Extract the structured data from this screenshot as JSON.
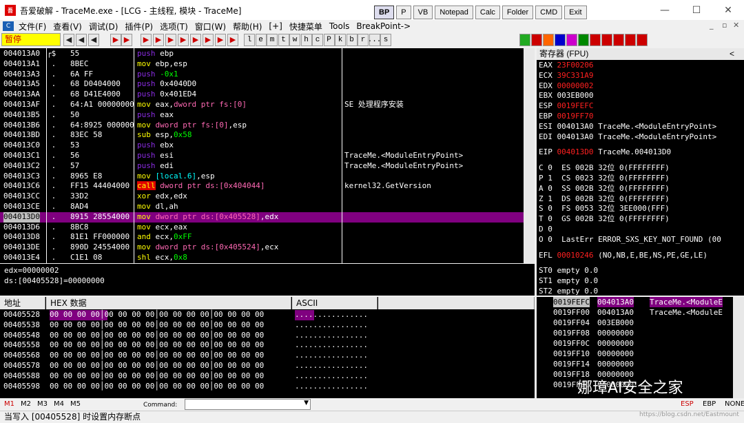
{
  "window": {
    "title": "吾爱破解 - TraceMe.exe - [LCG - 主线程, 模块 - TraceMe]",
    "icon_text": "吾"
  },
  "quick_buttons": [
    "BP",
    "P",
    "VB",
    "Notepad",
    "Calc",
    "Folder",
    "CMD",
    "Exit"
  ],
  "window_controls": {
    "min": "—",
    "max": "☐",
    "close": "✕"
  },
  "menu": [
    "文件(F)",
    "查看(V)",
    "调试(D)",
    "插件(P)",
    "选项(T)",
    "窗口(W)",
    "帮助(H)",
    "[+]",
    "快捷菜单",
    "Tools",
    "BreakPoint->"
  ],
  "mdi_controls": [
    "_",
    "▫",
    "✕"
  ],
  "toolbar": {
    "status": "暂停",
    "letters": [
      "l",
      "e",
      "m",
      "t",
      "w",
      "h",
      "c",
      "P",
      "k",
      "b",
      "r",
      "...",
      "s"
    ]
  },
  "disasm": [
    {
      "addr": "004013A0",
      "mark": "┌$",
      "hex": "55",
      "ins": [
        [
          "push",
          "t-push"
        ],
        [
          " ebp",
          "op"
        ]
      ],
      "cmt": ""
    },
    {
      "addr": "004013A1",
      "mark": " .",
      "hex": "8BEC",
      "ins": [
        [
          "mov",
          "t-mov"
        ],
        [
          " ebp,esp",
          "op"
        ]
      ],
      "cmt": ""
    },
    {
      "addr": "004013A3",
      "mark": " .",
      "hex": "6A FF",
      "ins": [
        [
          "push",
          "t-push"
        ],
        [
          " -0x1",
          "num"
        ]
      ],
      "cmt": ""
    },
    {
      "addr": "004013A5",
      "mark": " .",
      "hex": "68 D0404000",
      "ins": [
        [
          "push",
          "t-push"
        ],
        [
          " 0x4040D0",
          "op"
        ]
      ],
      "cmt": ""
    },
    {
      "addr": "004013AA",
      "mark": " .",
      "hex": "68 D41E4000",
      "ins": [
        [
          "push",
          "t-push"
        ],
        [
          " 0x401ED4",
          "op"
        ]
      ],
      "cmt": ""
    },
    {
      "addr": "004013AF",
      "mark": " .",
      "hex": "64:A1 00000000",
      "ins": [
        [
          "mov",
          "t-mov"
        ],
        [
          " eax,",
          "op"
        ],
        [
          "dword ptr fs:[0]",
          "mem"
        ]
      ],
      "cmt": "SE 处理程序安装"
    },
    {
      "addr": "004013B5",
      "mark": " .",
      "hex": "50",
      "ins": [
        [
          "push",
          "t-push"
        ],
        [
          " eax",
          "op"
        ]
      ],
      "cmt": ""
    },
    {
      "addr": "004013B6",
      "mark": " .",
      "hex": "64:8925 00000000",
      "ins": [
        [
          "mov",
          "t-mov"
        ],
        [
          " ",
          "op"
        ],
        [
          "dword ptr fs:[0]",
          "mem"
        ],
        [
          ",esp",
          "op"
        ]
      ],
      "cmt": ""
    },
    {
      "addr": "004013BD",
      "mark": " .",
      "hex": "83EC 58",
      "ins": [
        [
          "sub",
          "t-sub"
        ],
        [
          " esp,",
          "op"
        ],
        [
          "0x58",
          "num"
        ]
      ],
      "cmt": ""
    },
    {
      "addr": "004013C0",
      "mark": " .",
      "hex": "53",
      "ins": [
        [
          "push",
          "t-push"
        ],
        [
          " ebx",
          "op"
        ]
      ],
      "cmt": ""
    },
    {
      "addr": "004013C1",
      "mark": " .",
      "hex": "56",
      "ins": [
        [
          "push",
          "t-push"
        ],
        [
          " esi",
          "op"
        ]
      ],
      "cmt": "TraceMe.<ModuleEntryPoint>"
    },
    {
      "addr": "004013C2",
      "mark": " .",
      "hex": "57",
      "ins": [
        [
          "push",
          "t-push"
        ],
        [
          " edi",
          "op"
        ]
      ],
      "cmt": "TraceMe.<ModuleEntryPoint>"
    },
    {
      "addr": "004013C3",
      "mark": " .",
      "hex": "8965 E8",
      "ins": [
        [
          "mov",
          "t-mov"
        ],
        [
          " ",
          "op"
        ],
        [
          "[local.6]",
          "brk"
        ],
        [
          ",esp",
          "op"
        ]
      ],
      "cmt": ""
    },
    {
      "addr": "004013C6",
      "mark": " .",
      "hex": "FF15 44404000",
      "ins": [
        [
          "call",
          "t-call"
        ],
        [
          " ",
          "op"
        ],
        [
          "dword ptr ds:[0x404044]",
          "mem"
        ]
      ],
      "cmt": "kernel32.GetVersion"
    },
    {
      "addr": "004013CC",
      "mark": " .",
      "hex": "33D2",
      "ins": [
        [
          "xor",
          "t-xor"
        ],
        [
          " edx,edx",
          "op"
        ]
      ],
      "cmt": ""
    },
    {
      "addr": "004013CE",
      "mark": " .",
      "hex": "8AD4",
      "ins": [
        [
          "mov",
          "t-mov"
        ],
        [
          " dl,ah",
          "op"
        ]
      ],
      "cmt": ""
    },
    {
      "addr": "004013D0",
      "mark": " .",
      "hex": "8915 28554000",
      "ins": [
        [
          "mov",
          "t-mov"
        ],
        [
          " ",
          "op"
        ],
        [
          "dword ptr ds:[0x405528]",
          "mem"
        ],
        [
          ",edx",
          "op"
        ]
      ],
      "cmt": "",
      "sel": true
    },
    {
      "addr": "004013D6",
      "mark": " .",
      "hex": "8BC8",
      "ins": [
        [
          "mov",
          "t-mov"
        ],
        [
          " ecx,eax",
          "op"
        ]
      ],
      "cmt": ""
    },
    {
      "addr": "004013D8",
      "mark": " .",
      "hex": "81E1 FF000000",
      "ins": [
        [
          "and",
          "t-and"
        ],
        [
          " ecx,",
          "op"
        ],
        [
          "0xFF",
          "num"
        ]
      ],
      "cmt": ""
    },
    {
      "addr": "004013DE",
      "mark": " .",
      "hex": "890D 24554000",
      "ins": [
        [
          "mov",
          "t-mov"
        ],
        [
          " ",
          "op"
        ],
        [
          "dword ptr ds:[0x405524]",
          "mem"
        ],
        [
          ",ecx",
          "op"
        ]
      ],
      "cmt": ""
    },
    {
      "addr": "004013E4",
      "mark": " .",
      "hex": "C1E1 08",
      "ins": [
        [
          "shl",
          "t-shl"
        ],
        [
          " ecx,",
          "op"
        ],
        [
          "0x8",
          "num"
        ]
      ],
      "cmt": ""
    }
  ],
  "hint": [
    "edx=00000002",
    "ds:[00405528]=00000000"
  ],
  "registers": {
    "title": "寄存器 (FPU)",
    "lines": [
      {
        "t": "EAX ",
        "v": "23F00206",
        "c": "red",
        "r": ""
      },
      {
        "t": "ECX ",
        "v": "39C331A9",
        "c": "red",
        "r": ""
      },
      {
        "t": "EDX ",
        "v": "00000002",
        "c": "red",
        "r": ""
      },
      {
        "t": "EBX ",
        "v": "003EB000",
        "c": "",
        "r": ""
      },
      {
        "t": "ESP ",
        "v": "0019FEFC",
        "c": "red",
        "r": ""
      },
      {
        "t": "EBP ",
        "v": "0019FF70",
        "c": "red",
        "r": ""
      },
      {
        "t": "ESI ",
        "v": "004013A0",
        "c": "",
        "r": " TraceMe.<ModuleEntryPoint>"
      },
      {
        "t": "EDI ",
        "v": "004013A0",
        "c": "",
        "r": " TraceMe.<ModuleEntryPoint>"
      },
      {
        "t": "",
        "v": "",
        "c": "",
        "r": ""
      },
      {
        "t": "EIP ",
        "v": "004013D0",
        "c": "red",
        "r": " TraceMe.004013D0"
      },
      {
        "t": "",
        "v": "",
        "c": "",
        "r": ""
      },
      {
        "t": "C 0  ES 002B 32位 0(FFFFFFFF)",
        "v": "",
        "c": "",
        "r": ""
      },
      {
        "t": "P 1  CS 0023 32位 0(FFFFFFFF)",
        "v": "",
        "c": "",
        "r": ""
      },
      {
        "t": "A 0  SS 002B 32位 0(FFFFFFFF)",
        "v": "",
        "c": "",
        "r": ""
      },
      {
        "t": "Z 1  DS 002B 32位 0(FFFFFFFF)",
        "v": "",
        "c": "",
        "r": ""
      },
      {
        "t": "S 0  FS 0053 32位 3EE000(FFF)",
        "v": "",
        "c": "",
        "r": ""
      },
      {
        "t": "T 0  GS 002B 32位 0(FFFFFFFF)",
        "v": "",
        "c": "",
        "r": ""
      },
      {
        "t": "D 0",
        "v": "",
        "c": "",
        "r": ""
      },
      {
        "t": "O 0  LastErr ERROR_SXS_KEY_NOT_FOUND (00",
        "v": "",
        "c": "",
        "r": ""
      },
      {
        "t": "",
        "v": "",
        "c": "",
        "r": ""
      },
      {
        "t": "EFL ",
        "v": "00010246",
        "c": "red",
        "r": " (NO,NB,E,BE,NS,PE,GE,LE)"
      },
      {
        "t": "",
        "v": "",
        "c": "",
        "r": ""
      },
      {
        "t": "ST0 empty 0.0",
        "v": "",
        "c": "",
        "r": ""
      },
      {
        "t": "ST1 empty 0.0",
        "v": "",
        "c": "",
        "r": ""
      },
      {
        "t": "ST2 empty 0.0",
        "v": "",
        "c": "",
        "r": ""
      }
    ]
  },
  "memory": {
    "headers": [
      "地址",
      "HEX 数据",
      "ASCII"
    ],
    "rows": [
      {
        "addr": "00405528",
        "hex": "00 00 00 00│00 00 00 00│00 00 00 00│00 00 00 00",
        "ascii": "................",
        "hl": true
      },
      {
        "addr": "00405538",
        "hex": "00 00 00 00│00 00 00 00│00 00 00 00│00 00 00 00",
        "ascii": "................"
      },
      {
        "addr": "00405548",
        "hex": "00 00 00 00│00 00 00 00│00 00 00 00│00 00 00 00",
        "ascii": "................"
      },
      {
        "addr": "00405558",
        "hex": "00 00 00 00│00 00 00 00│00 00 00 00│00 00 00 00",
        "ascii": "................"
      },
      {
        "addr": "00405568",
        "hex": "00 00 00 00│00 00 00 00│00 00 00 00│00 00 00 00",
        "ascii": "................"
      },
      {
        "addr": "00405578",
        "hex": "00 00 00 00│00 00 00 00│00 00 00 00│00 00 00 00",
        "ascii": "................"
      },
      {
        "addr": "00405588",
        "hex": "00 00 00 00│00 00 00 00│00 00 00 00│00 00 00 00",
        "ascii": "................"
      },
      {
        "addr": "00405598",
        "hex": "00 00 00 00│00 00 00 00│00 00 00 00│00 00 00 00",
        "ascii": "................"
      }
    ]
  },
  "stack": [
    {
      "addr": "0019FEFC",
      "val": "004013A0",
      "cmt": "TraceMe.<ModuleE",
      "hl": true
    },
    {
      "addr": "0019FF00",
      "val": "004013A0",
      "cmt": "TraceMe.<ModuleE"
    },
    {
      "addr": "0019FF04",
      "val": "003EB000",
      "cmt": ""
    },
    {
      "addr": "0019FF08",
      "val": "00000000",
      "cmt": ""
    },
    {
      "addr": "0019FF0C",
      "val": "00000000",
      "cmt": ""
    },
    {
      "addr": "0019FF10",
      "val": "00000000",
      "cmt": ""
    },
    {
      "addr": "0019FF14",
      "val": "00000000",
      "cmt": ""
    },
    {
      "addr": "0019FF18",
      "val": "00000000",
      "cmt": ""
    },
    {
      "addr": "0019FF1C",
      "val": "00000000",
      "cmt": ""
    }
  ],
  "bottom": {
    "tabs": [
      "M1",
      "M2",
      "M3",
      "M4",
      "M5"
    ],
    "command_label": "Command:",
    "regs": [
      "ESP",
      "EBP",
      "NONE"
    ]
  },
  "status": "当写入 [00405528] 时设置内存断点",
  "watermark": "娜璋AI安全之家",
  "watermark2": "https://blog.csdn.net/Eastmount"
}
